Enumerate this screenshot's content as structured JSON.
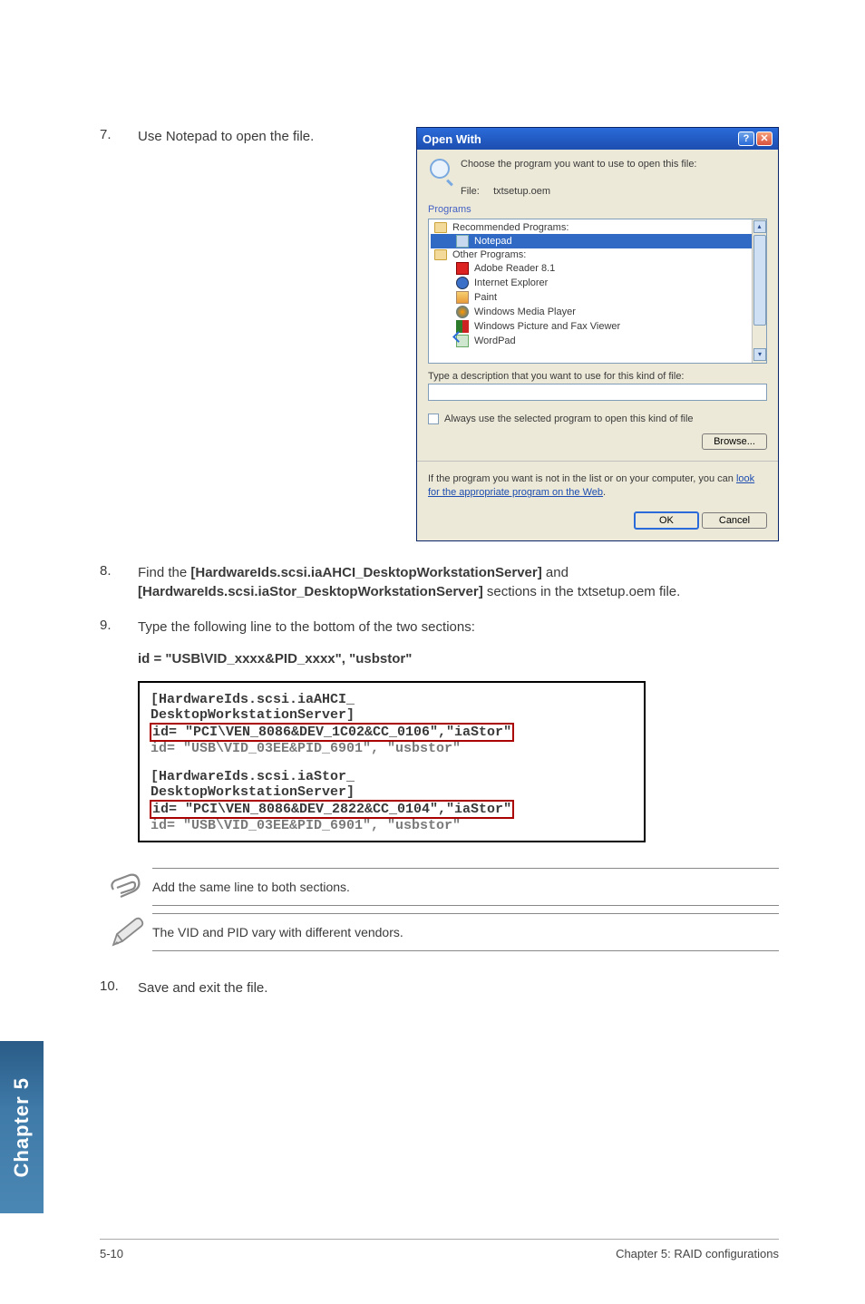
{
  "steps": {
    "7": {
      "num": "7.",
      "text": "Use Notepad to open the file."
    },
    "8": {
      "num": "8.",
      "prefix": "Find the ",
      "bold1": "[HardwareIds.scsi.iaAHCI_DesktopWorkstationServer]",
      "mid": " and ",
      "bold2": "[HardwareIds.scsi.iaStor_DesktopWorkstationServer]",
      "suffix": " sections in the txtsetup.oem file."
    },
    "9": {
      "num": "9.",
      "text": "Type the following line to the bottom of the two sections:"
    },
    "9_code": "id = \"USB\\VID_xxxx&PID_xxxx\", \"usbstor\"",
    "10": {
      "num": "10.",
      "text": "Save and exit the file."
    }
  },
  "dialog": {
    "title": "Open With",
    "choose": "Choose the program you want to use to open this file:",
    "file_label": "File:",
    "file_name": "txtsetup.oem",
    "programs_label": "Programs",
    "recommended": "Recommended Programs:",
    "other": "Other Programs:",
    "items": {
      "notepad": "Notepad",
      "adobe": "Adobe Reader 8.1",
      "ie": "Internet Explorer",
      "paint": "Paint",
      "wmp": "Windows Media Player",
      "picfax": "Windows Picture and Fax Viewer",
      "wordpad": "WordPad"
    },
    "desc_label": "Type a description that you want to use for this kind of file:",
    "always": "Always use the selected program to open this kind of file",
    "browse": "Browse...",
    "weblink_pre": "If the program you want is not in the list or on your computer, you can ",
    "weblink_link": "look for the appropriate program on the Web",
    "weblink_post": ".",
    "ok": "OK",
    "cancel": "Cancel"
  },
  "codeblock": {
    "l1": "[HardwareIds.scsi.iaAHCI_",
    "l2": "DesktopWorkstationServer]",
    "l3": "id= \"PCI\\VEN_8086&DEV_1C02&CC_0106\",\"iaStor\"",
    "l4": "id= \"USB\\VID_03EE&PID_6901\", \"usbstor\"",
    "l5": "[HardwareIds.scsi.iaStor_",
    "l6": "DesktopWorkstationServer]",
    "l7": "id= \"PCI\\VEN_8086&DEV_2822&CC_0104\",\"iaStor\"",
    "l8": "id= \"USB\\VID_03EE&PID_6901\", \"usbstor\""
  },
  "notes": {
    "note1": "Add the same line to both sections.",
    "note2": "The VID and PID vary with different vendors."
  },
  "chapter_tab": "Chapter 5",
  "footer": {
    "left": "5-10",
    "right": "Chapter 5: RAID configurations"
  }
}
